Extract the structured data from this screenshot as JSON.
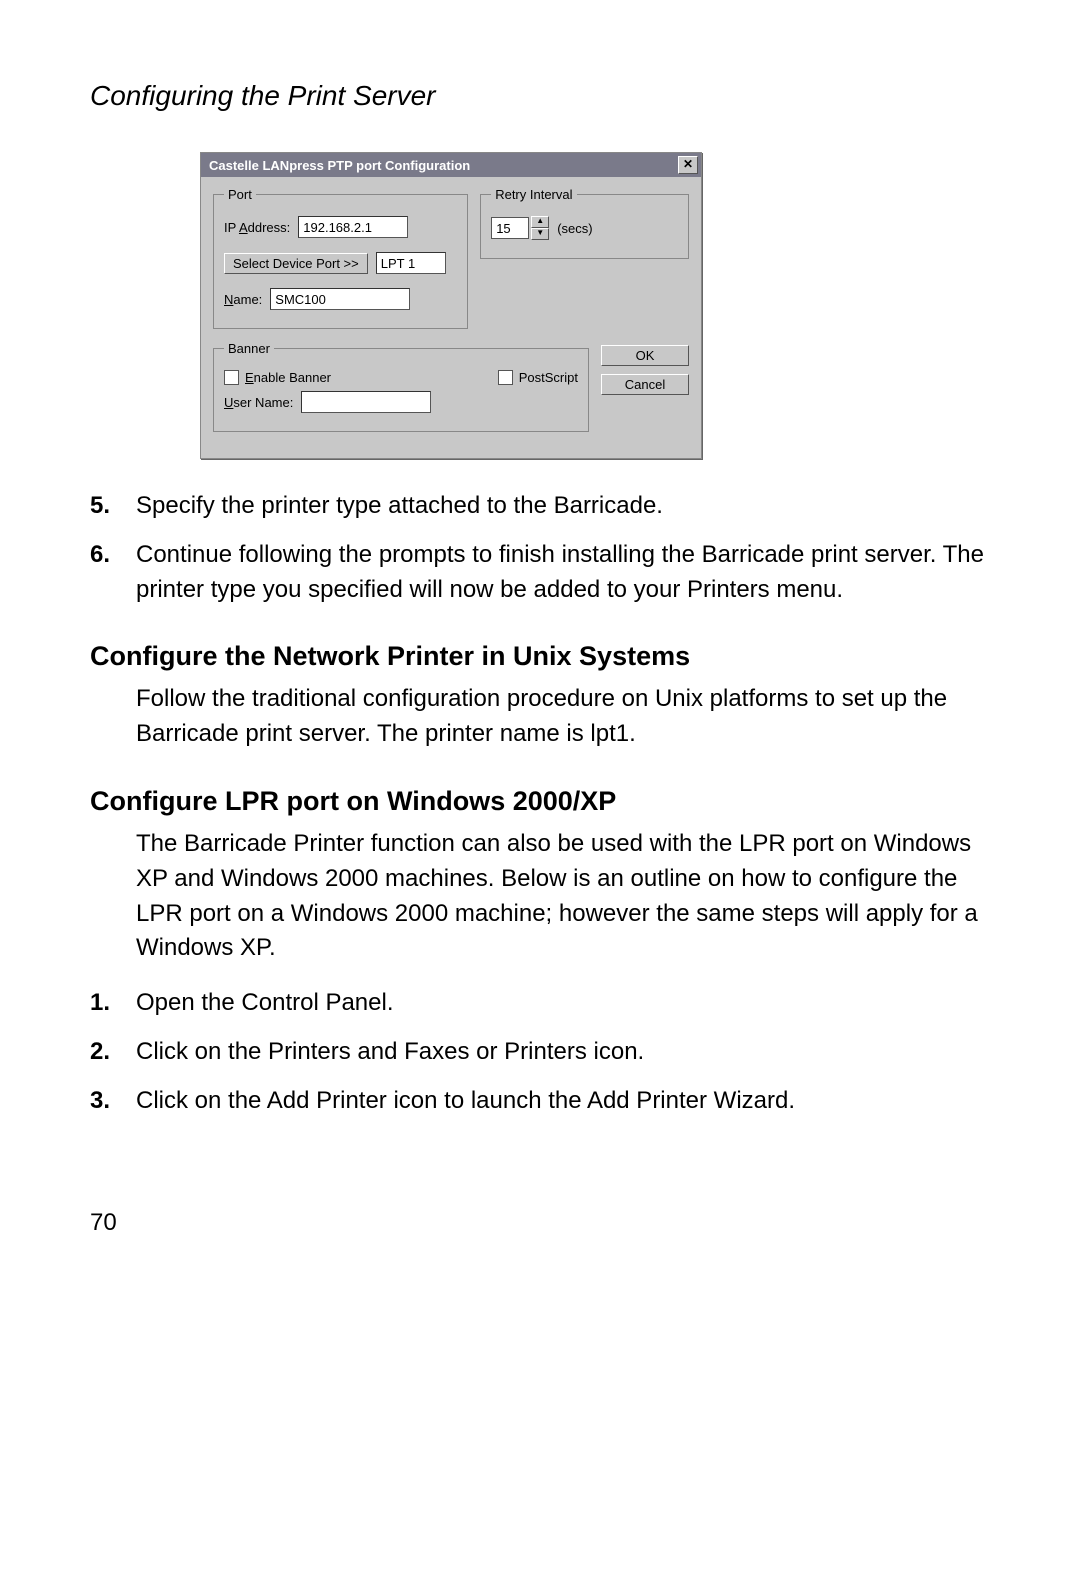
{
  "header": "Configuring the Print Server",
  "dialog": {
    "title": "Castelle LANpress PTP port  Configuration",
    "close_glyph": "✕",
    "port": {
      "legend": "Port",
      "ip_label_pre": "IP ",
      "ip_label_u": "A",
      "ip_label_post": "ddress:",
      "ip_value": "192.168.2.1",
      "select_btn": "Select Device Port >>",
      "device_port_value": "LPT 1",
      "name_label_u": "N",
      "name_label_post": "ame:",
      "name_value": "SMC100"
    },
    "retry": {
      "legend": "Retry Interval",
      "value": "15",
      "unit": "(secs)"
    },
    "banner": {
      "legend": "Banner",
      "enable_u": "E",
      "enable_post": "nable Banner",
      "postscript": "PostScript",
      "user_u": "U",
      "user_post": "ser Name:",
      "user_value": ""
    },
    "ok": "OK",
    "cancel": "Cancel"
  },
  "steps_a": [
    {
      "n": "5.",
      "t": "Specify the printer type attached to the Barricade."
    },
    {
      "n": "6.",
      "t": "Continue following the prompts to finish installing the Barricade print server. The printer type you specified will now be added to your Printers menu."
    }
  ],
  "section_unix": {
    "heading": "Configure the Network Printer in Unix Systems",
    "body": "Follow the traditional configuration procedure on Unix platforms to set up the Barricade print server. The printer name is lpt1."
  },
  "section_lpr": {
    "heading": "Configure LPR port on Windows 2000/XP",
    "body": "The Barricade Printer function can also be used with the LPR port on Windows XP and Windows 2000 machines. Below is an outline on how to configure the LPR port on a Windows 2000 machine; however the same steps will apply for a Windows XP."
  },
  "steps_b": [
    {
      "n": "1.",
      "t": "Open the Control Panel."
    },
    {
      "n": "2.",
      "t": "Click on the Printers and Faxes or Printers icon."
    },
    {
      "n": "3.",
      "t": "Click on the Add Printer icon to launch the Add Printer Wizard."
    }
  ],
  "page_number": "70"
}
